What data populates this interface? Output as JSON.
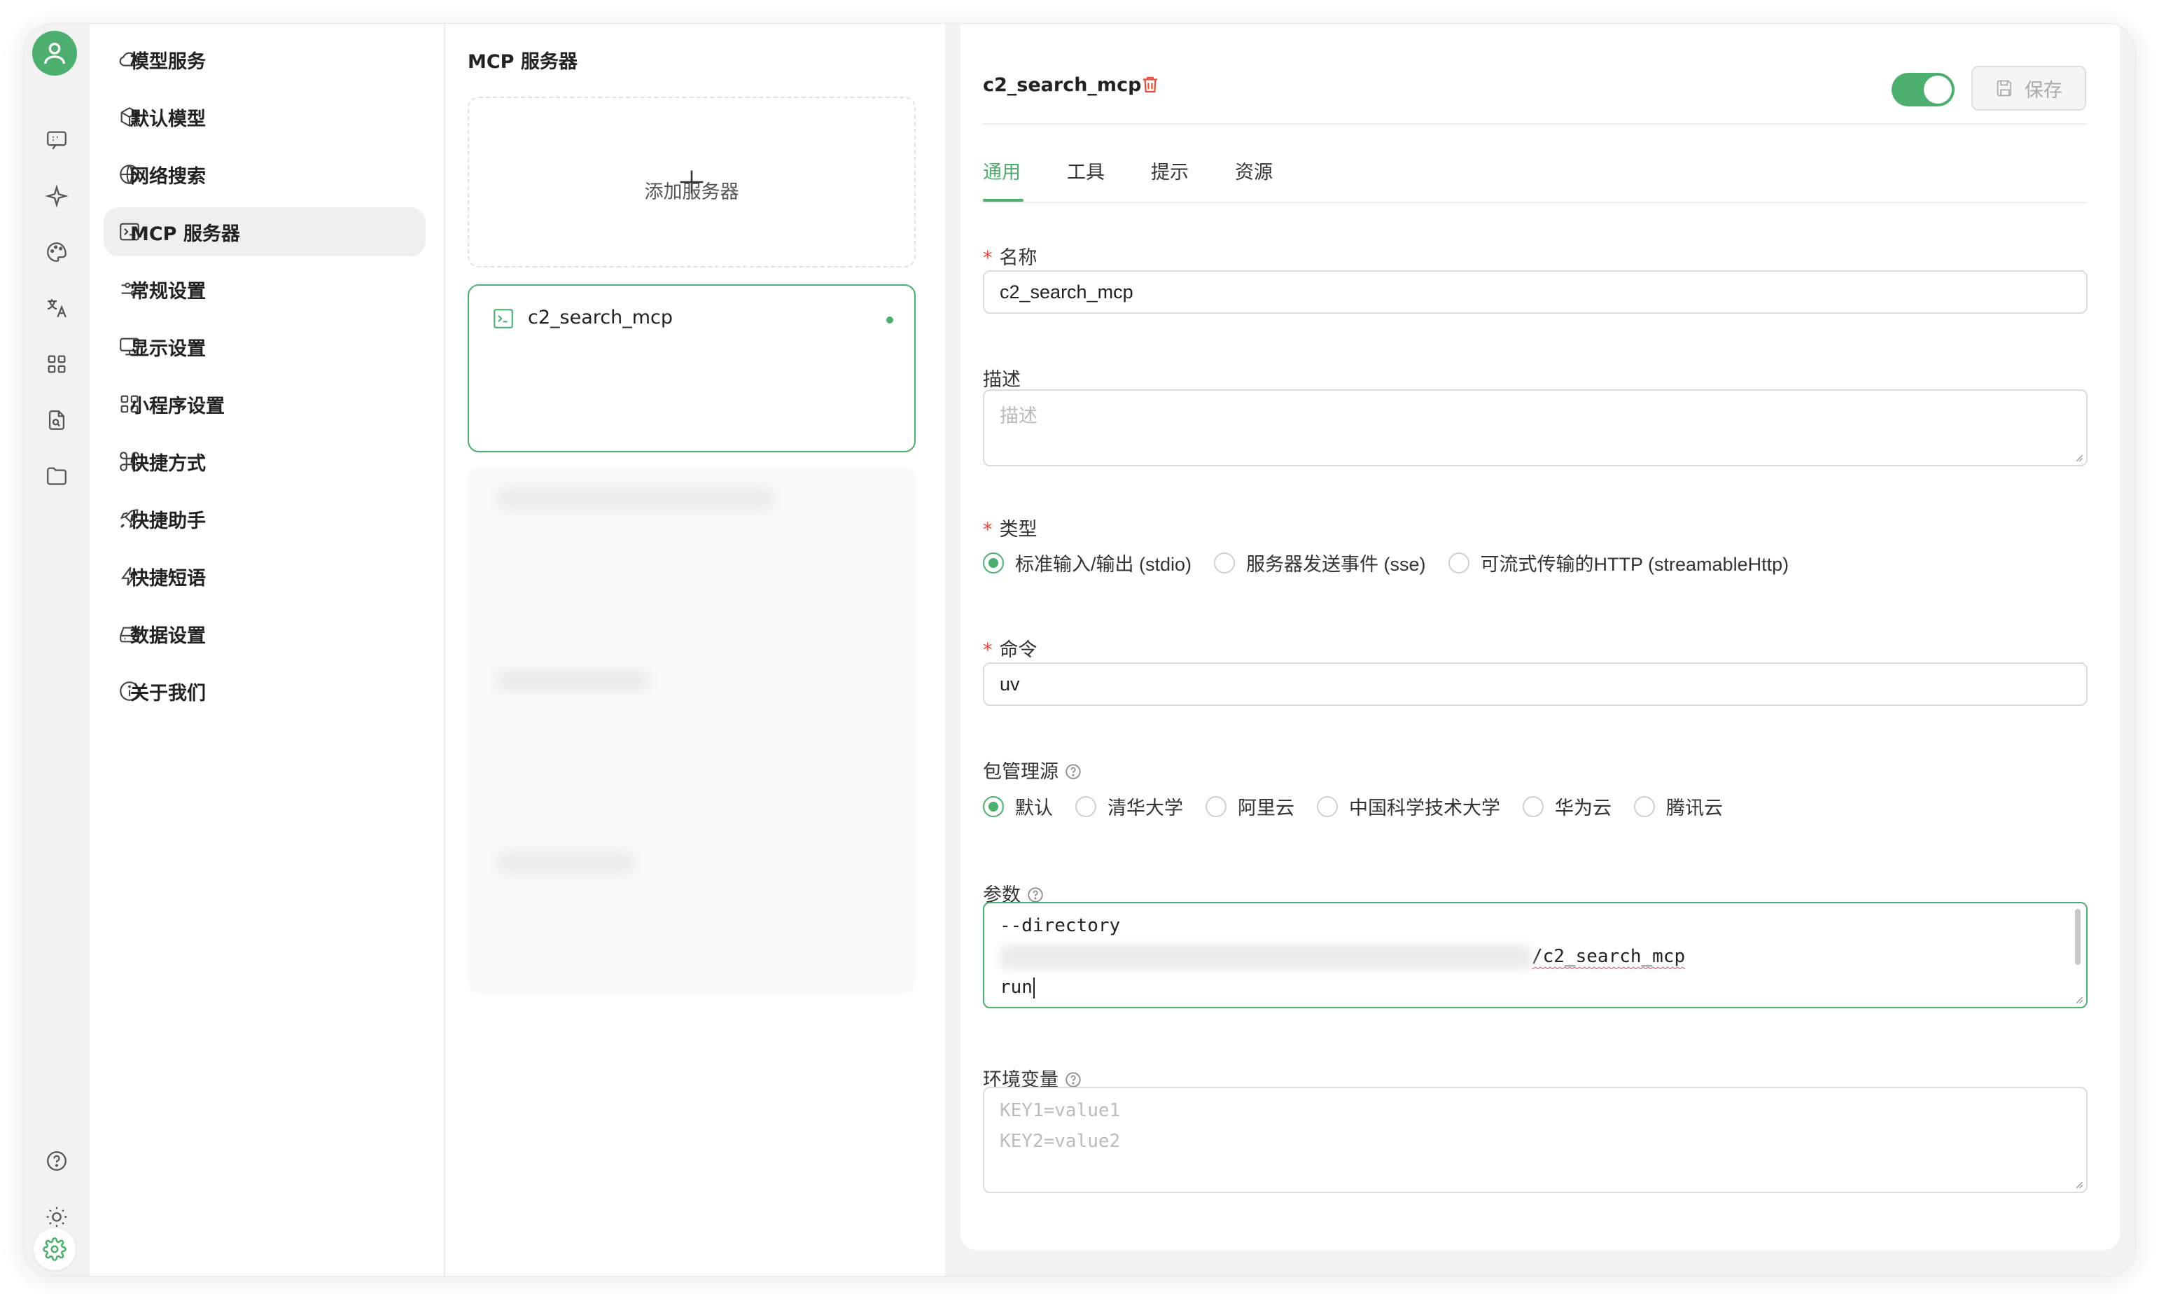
{
  "menu": {
    "items": [
      {
        "label": "模型服务",
        "icon": "cloud-icon"
      },
      {
        "label": "默认模型",
        "icon": "cube-icon"
      },
      {
        "label": "网络搜索",
        "icon": "globe-icon"
      },
      {
        "label": "MCP 服务器",
        "icon": "terminal-icon"
      },
      {
        "label": "常规设置",
        "icon": "sliders-icon"
      },
      {
        "label": "显示设置",
        "icon": "monitor-icon"
      },
      {
        "label": "小程序设置",
        "icon": "grid-icon"
      },
      {
        "label": "快捷方式",
        "icon": "command-icon"
      },
      {
        "label": "快捷助手",
        "icon": "rocket-icon"
      },
      {
        "label": "快捷短语",
        "icon": "zap-icon"
      },
      {
        "label": "数据设置",
        "icon": "drive-icon"
      },
      {
        "label": "关于我们",
        "icon": "info-icon"
      }
    ],
    "active_index": 3
  },
  "server_list": {
    "title": "MCP 服务器",
    "add_label": "添加服务器",
    "selected_server": "c2_search_mcp"
  },
  "detail": {
    "title": "c2_search_mcp",
    "save_label": "保存",
    "enabled": true,
    "tabs": [
      "通用",
      "工具",
      "提示",
      "资源"
    ],
    "active_tab": 0,
    "name_label": "名称",
    "name_value": "c2_search_mcp",
    "desc_label": "描述",
    "desc_placeholder": "描述",
    "type_label": "类型",
    "type_options": [
      "标准输入/输出 (stdio)",
      "服务器发送事件 (sse)",
      "可流式传输的HTTP (streamableHttp)"
    ],
    "type_selected": 0,
    "command_label": "命令",
    "command_value": "uv",
    "registry_label": "包管理源",
    "registry_options": [
      "默认",
      "清华大学",
      "阿里云",
      "中国科学技术大学",
      "华为云",
      "腾讯云"
    ],
    "registry_selected": 0,
    "args_label": "参数",
    "args_line1": "--directory",
    "args_line2_suffix": "/c2_search_mcp",
    "args_line3": "run",
    "env_label": "环境变量",
    "env_placeholder_line1": "KEY1=value1",
    "env_placeholder_line2": "KEY2=value2"
  },
  "colors": {
    "accent": "#4caf6d",
    "danger": "#e74c3c"
  }
}
